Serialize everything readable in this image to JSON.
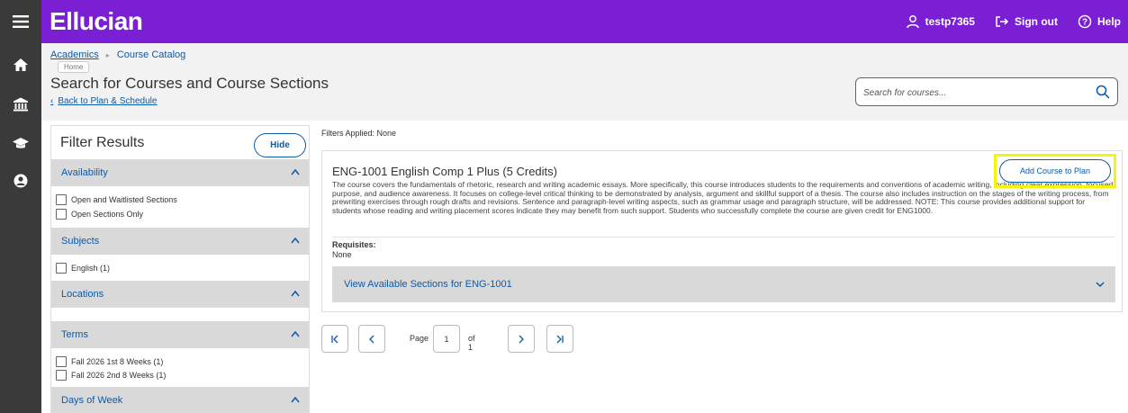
{
  "app": {
    "logo": "Ellucian",
    "username": "testp7365",
    "sign_out_label": "Sign out",
    "help_label": "Help",
    "brand_color": "#7a1fd4"
  },
  "rail": {
    "icons": [
      "home-icon",
      "institution-icon",
      "graduation-cap-icon",
      "user-circle-icon"
    ]
  },
  "breadcrumb": {
    "items": [
      "Academics",
      "Course Catalog"
    ],
    "tooltip": "Home"
  },
  "header": {
    "title": "Search for Courses and Course Sections",
    "back_link": "Back to Plan & Schedule"
  },
  "search": {
    "placeholder": "Search for courses..."
  },
  "filter": {
    "title": "Filter Results",
    "hide_label": "Hide",
    "sections": [
      {
        "label": "Availability",
        "options": [
          "Open and Waitlisted Sections",
          "Open Sections Only"
        ]
      },
      {
        "label": "Subjects",
        "options": [
          "English (1)"
        ]
      },
      {
        "label": "Locations",
        "options": []
      },
      {
        "label": "Terms",
        "options": [
          "Fall 2026 1st 8 Weeks (1)",
          "Fall 2026 2nd 8 Weeks (1)"
        ]
      },
      {
        "label": "Days of Week",
        "options": []
      }
    ]
  },
  "results": {
    "filters_applied": "Filters Applied: None",
    "course": {
      "title": "ENG-1001 English Comp 1 Plus (5 Credits)",
      "add_button": "Add Course to Plan",
      "description": "The course covers the fundamentals of rhetoric, research and writing academic essays. More specifically, this course introduces students to the requirements and conventions of academic writing, including clear expression, focused purpose, and audience awareness. It focuses on college-level critical thinking to be demonstrated by analysis, argument and skillful support of a thesis. The course also includes instruction on the stages of the writing process, from prewriting exercises through rough drafts and revisions. Sentence and paragraph-level writing aspects, such as grammar usage and paragraph structure, will be addressed. NOTE: This course provides additional support for students whose reading and writing placement scores indicate they may benefit from such support. Students who successfully complete the course are given credit for ENG1000.",
      "requisites_label": "Requisites:",
      "requisites_value": "None",
      "sections_label": "View Available Sections for ENG-1001"
    }
  },
  "pagination": {
    "page_label": "Page",
    "current_page": "1",
    "of_label": "of 1"
  }
}
